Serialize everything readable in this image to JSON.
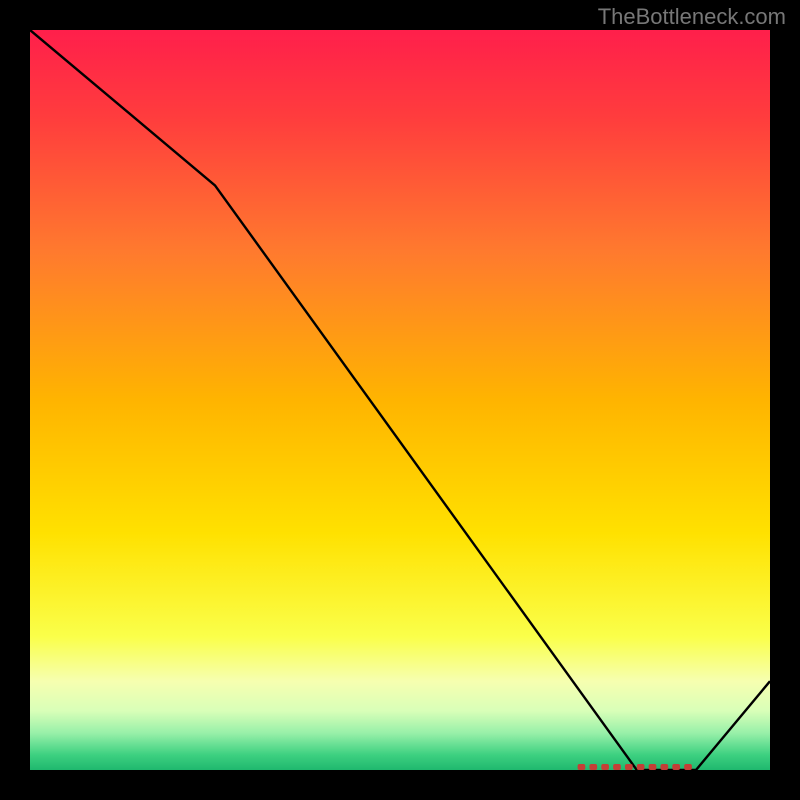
{
  "watermark": "TheBottleneck.com",
  "marker": {
    "label": ""
  },
  "chart_data": {
    "type": "line",
    "title": "",
    "xlabel": "",
    "ylabel": "",
    "xlim": [
      0,
      100
    ],
    "ylim": [
      0,
      100
    ],
    "grid": false,
    "series": [
      {
        "name": "curve",
        "x": [
          0,
          25,
          82,
          90,
          100
        ],
        "values": [
          100,
          79,
          0,
          0,
          12
        ]
      }
    ],
    "marker_band": {
      "x_start": 74,
      "x_end": 90,
      "y": 0
    },
    "gradient_stops": [
      {
        "offset": 0.0,
        "color": "#ff1f4b"
      },
      {
        "offset": 0.12,
        "color": "#ff3d3d"
      },
      {
        "offset": 0.3,
        "color": "#ff7a2e"
      },
      {
        "offset": 0.5,
        "color": "#ffb400"
      },
      {
        "offset": 0.68,
        "color": "#ffe100"
      },
      {
        "offset": 0.82,
        "color": "#faff4a"
      },
      {
        "offset": 0.88,
        "color": "#f6ffb0"
      },
      {
        "offset": 0.92,
        "color": "#d9ffb8"
      },
      {
        "offset": 0.95,
        "color": "#98f0a9"
      },
      {
        "offset": 0.98,
        "color": "#3cd080"
      },
      {
        "offset": 1.0,
        "color": "#1fb86e"
      }
    ]
  }
}
